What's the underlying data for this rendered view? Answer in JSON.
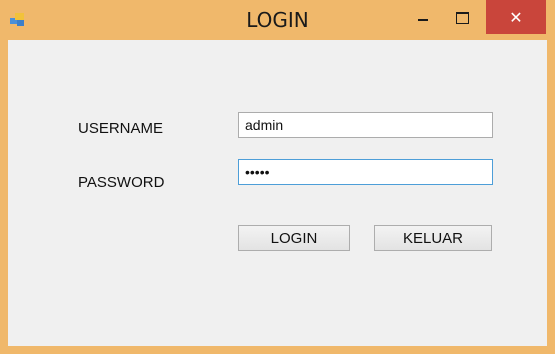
{
  "window": {
    "title": "LOGIN",
    "close_symbol": "✕",
    "icons": {
      "app": "app-icon",
      "minimize": "minimize-icon",
      "maximize": "maximize-icon",
      "close": "close-icon"
    },
    "colors": {
      "frame": "#f0b86b",
      "close_button": "#c9453b",
      "client": "#f0f0f0",
      "focus_border": "#4d9ed8"
    }
  },
  "form": {
    "username_label": "USERNAME",
    "username_value": "admin",
    "password_label": "PASSWORD",
    "password_value": "admin"
  },
  "buttons": {
    "login_label": "LOGIN",
    "keluar_label": "KELUAR"
  }
}
